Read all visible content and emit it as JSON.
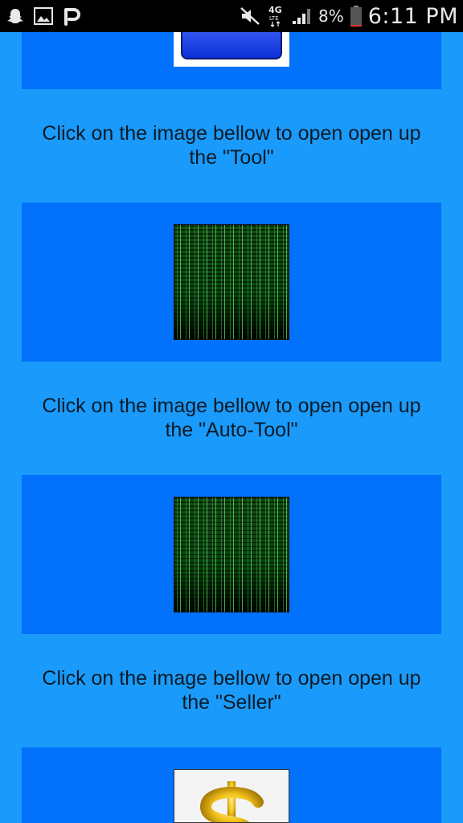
{
  "status_bar": {
    "left_icons": [
      "snapchat-icon",
      "image-icon",
      "p-app-icon"
    ],
    "network_label": "4G",
    "battery_percent": "8%",
    "battery_level": 0.08,
    "time": "6:11 PM"
  },
  "sections": [
    {
      "caption_line1": "Click on the image bellow to open open up",
      "caption_line2": "the \"Tool\""
    },
    {
      "caption_line1": "Click on the image bellow to open open up",
      "caption_line2": "the \"Auto-Tool\""
    },
    {
      "caption_line1": "Click on the image bellow to open open up",
      "caption_line2": "the \"Seller\""
    }
  ]
}
